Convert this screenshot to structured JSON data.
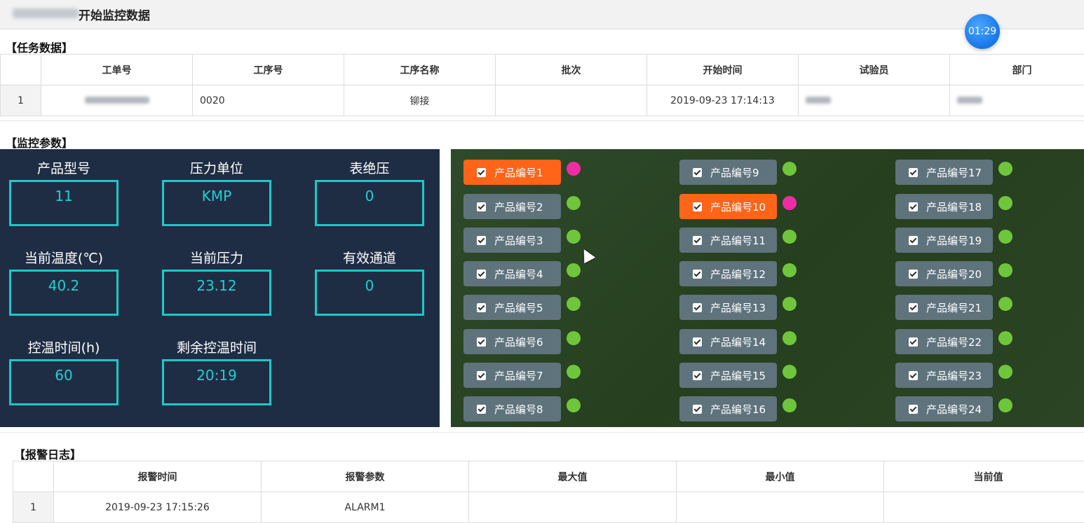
{
  "header": {
    "title": "开始监控数据",
    "timer": "01:29"
  },
  "task": {
    "section_title": "【任务数据】",
    "columns": [
      "",
      "工单号",
      "工序号",
      "工序名称",
      "批次",
      "开始时间",
      "试验员",
      "部门"
    ],
    "row": {
      "index": "1",
      "work_order": "",
      "process_no": "0020",
      "process_name": "铆接",
      "batch": "",
      "start_time": "2019-09-23 17:14:13",
      "tester": "",
      "department": ""
    }
  },
  "monitor": {
    "section_title": "【监控参数】",
    "params": [
      {
        "label": "产品型号",
        "value": "11"
      },
      {
        "label": "压力单位",
        "value": "KMP"
      },
      {
        "label": "表绝压",
        "value": "0"
      },
      {
        "label": "当前温度(℃)",
        "value": "40.2"
      },
      {
        "label": "当前压力",
        "value": "23.12"
      },
      {
        "label": "有效通道",
        "value": "0"
      },
      {
        "label": "控温时间(h)",
        "value": "60"
      },
      {
        "label": "剩余控温时间",
        "value": "20:19"
      }
    ],
    "products": [
      {
        "label": "产品编号1",
        "status": "alarm"
      },
      {
        "label": "产品编号2",
        "status": "ok"
      },
      {
        "label": "产品编号3",
        "status": "ok"
      },
      {
        "label": "产品编号4",
        "status": "ok"
      },
      {
        "label": "产品编号5",
        "status": "ok"
      },
      {
        "label": "产品编号6",
        "status": "ok"
      },
      {
        "label": "产品编号7",
        "status": "ok"
      },
      {
        "label": "产品编号8",
        "status": "ok"
      },
      {
        "label": "产品编号9",
        "status": "ok"
      },
      {
        "label": "产品编号10",
        "status": "alarm"
      },
      {
        "label": "产品编号11",
        "status": "ok"
      },
      {
        "label": "产品编号12",
        "status": "ok"
      },
      {
        "label": "产品编号13",
        "status": "ok"
      },
      {
        "label": "产品编号14",
        "status": "ok"
      },
      {
        "label": "产品编号15",
        "status": "ok"
      },
      {
        "label": "产品编号16",
        "status": "ok"
      },
      {
        "label": "产品编号17",
        "status": "ok"
      },
      {
        "label": "产品编号18",
        "status": "ok"
      },
      {
        "label": "产品编号19",
        "status": "ok"
      },
      {
        "label": "产品编号20",
        "status": "ok"
      },
      {
        "label": "产品编号21",
        "status": "ok"
      },
      {
        "label": "产品编号22",
        "status": "ok"
      },
      {
        "label": "产品编号23",
        "status": "ok"
      },
      {
        "label": "产品编号24",
        "status": "ok"
      }
    ],
    "colors": {
      "ok": "#6fc63c",
      "alarm_dot": "#ef2ca6",
      "alarm_button": "#ff6418"
    }
  },
  "alarm_log": {
    "section_title": "【报警日志】",
    "columns": [
      "",
      "报警时间",
      "报警参数",
      "最大值",
      "最小值",
      "当前值"
    ],
    "row": {
      "index": "1",
      "time": "2019-09-23 17:15:26",
      "param": "ALARM1",
      "max": "",
      "min": "",
      "current": ""
    }
  }
}
